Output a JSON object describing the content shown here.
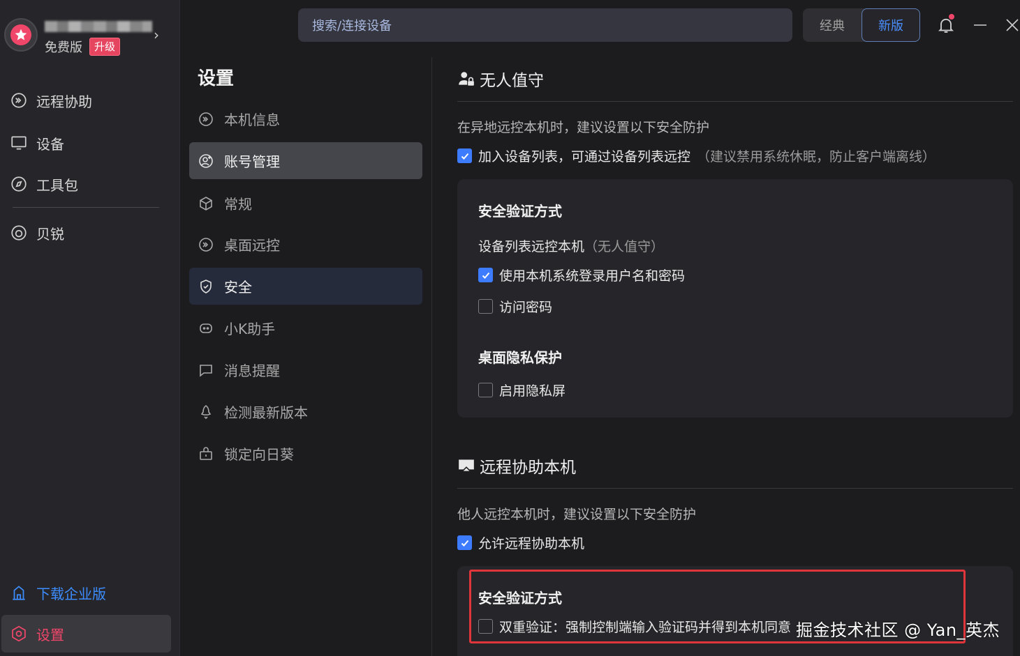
{
  "profile": {
    "plan": "免费版",
    "upgrade": "升级"
  },
  "sidebar": {
    "items": [
      {
        "label": "远程协助",
        "icon": "remote-assist-icon"
      },
      {
        "label": "设备",
        "icon": "monitor-icon"
      },
      {
        "label": "工具包",
        "icon": "compass-icon"
      },
      {
        "label": "贝锐",
        "icon": "oray-icon"
      }
    ],
    "download": "下载企业版",
    "settings": "设置"
  },
  "topbar": {
    "search_placeholder": "搜索/连接设备",
    "mode_classic": "经典",
    "mode_new": "新版"
  },
  "settings_menu": {
    "title": "设置",
    "items": [
      {
        "label": "本机信息",
        "icon": "device-info-icon"
      },
      {
        "label": "账号管理",
        "icon": "account-icon",
        "state": "hover"
      },
      {
        "label": "常规",
        "icon": "cube-icon"
      },
      {
        "label": "桌面远控",
        "icon": "desktop-remote-icon"
      },
      {
        "label": "安全",
        "icon": "shield-icon",
        "state": "active"
      },
      {
        "label": "小K助手",
        "icon": "assistant-icon"
      },
      {
        "label": "消息提醒",
        "icon": "message-icon"
      },
      {
        "label": "检测最新版本",
        "icon": "rocket-icon"
      },
      {
        "label": "锁定向日葵",
        "icon": "lock-icon"
      }
    ]
  },
  "unattended": {
    "title": "无人值守",
    "desc": "在异地远控本机时，建议设置以下安全防护",
    "add_device": {
      "label": "加入设备列表，可通过设备列表远控",
      "hint": "（建议禁用系统休眠，防止客户端离线）",
      "checked": true
    },
    "verify_title": "安全验证方式",
    "device_list_label": "设备列表远控本机",
    "device_list_hint": "（无人值守）",
    "use_system_login": {
      "label": "使用本机系统登录用户名和密码",
      "checked": true
    },
    "access_password": {
      "label": "访问密码",
      "checked": false
    },
    "privacy_title": "桌面隐私保护",
    "privacy_screen": {
      "label": "启用隐私屏",
      "checked": false
    }
  },
  "remote_assist": {
    "title": "远程协助本机",
    "desc": "他人远控本机时，建议设置以下安全防护",
    "allow": {
      "label": "允许远程协助本机",
      "checked": true
    },
    "verify_title": "安全验证方式",
    "two_factor": {
      "label": "双重验证：强制控制端输入验证码并得到本机同意",
      "checked": false
    }
  },
  "watermark": "掘金技术社区 @ Yan_英杰",
  "colors": {
    "accent": "#3d7bff",
    "brand": "#f0466a",
    "highlight": "#e0353b"
  }
}
